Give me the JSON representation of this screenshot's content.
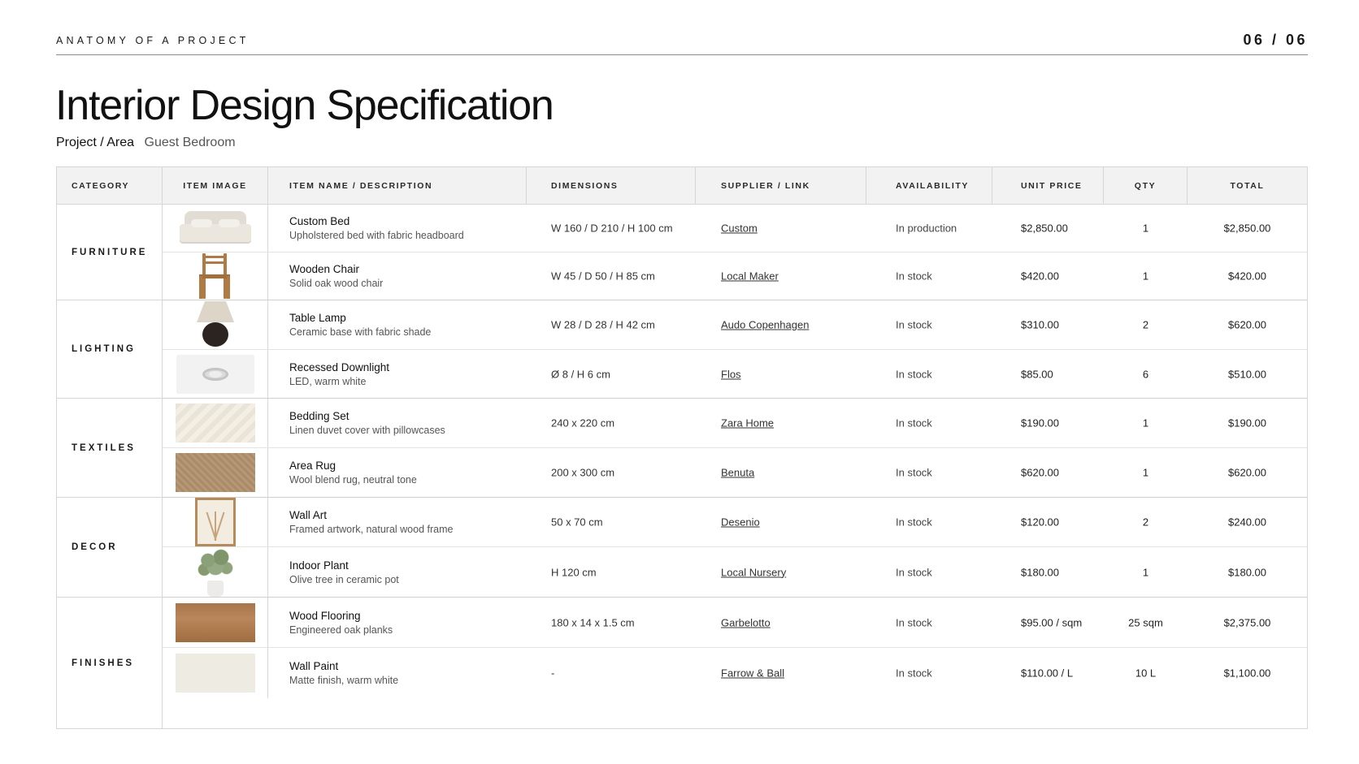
{
  "header": {
    "kicker": "ANATOMY OF A PROJECT",
    "page": "06 / 06"
  },
  "title": "Interior Design Specification",
  "project": {
    "label": "Project / Area",
    "value": "Guest Bedroom"
  },
  "table": {
    "columns": [
      "CATEGORY",
      "ITEM IMAGE",
      "ITEM NAME / DESCRIPTION",
      "DIMENSIONS",
      "SUPPLIER / LINK",
      "AVAILABILITY",
      "UNIT PRICE",
      "QTY",
      "TOTAL"
    ],
    "categories": [
      "FURNITURE",
      "LIGHTING",
      "TEXTILES",
      "DECOR",
      "FINISHES"
    ],
    "rows": [
      {
        "image": "bed-image",
        "name": "Custom Bed",
        "description": "Upholstered bed with fabric headboard",
        "dimensions": "W 160 / D 210 / H 100 cm",
        "supplier": "Custom",
        "availability": "In production",
        "unit_price": "$2,850.00",
        "qty": "1",
        "total": "$2,850.00"
      },
      {
        "image": "chair-image",
        "name": "Wooden Chair",
        "description": "Solid oak wood chair",
        "dimensions": "W 45 / D 50 / H 85 cm",
        "supplier": "Local Maker",
        "availability": "In stock",
        "unit_price": "$420.00",
        "qty": "1",
        "total": "$420.00"
      },
      {
        "image": "lamp-image",
        "name": "Table Lamp",
        "description": "Ceramic base with fabric shade",
        "dimensions": "W 28 / D 28 / H 42 cm",
        "supplier": "Audo Copenhagen",
        "availability": "In stock",
        "unit_price": "$310.00",
        "qty": "2",
        "total": "$620.00"
      },
      {
        "image": "downlight-image",
        "name": "Recessed Downlight",
        "description": "LED, warm white",
        "dimensions": "Ø 8 / H 6 cm",
        "supplier": "Flos",
        "availability": "In stock",
        "unit_price": "$85.00",
        "qty": "6",
        "total": "$510.00"
      },
      {
        "image": "bedding-image",
        "name": "Bedding Set",
        "description": "Linen duvet cover with pillowcases",
        "dimensions": "240 x 220 cm",
        "supplier": "Zara Home",
        "availability": "In stock",
        "unit_price": "$190.00",
        "qty": "1",
        "total": "$190.00"
      },
      {
        "image": "rug-image",
        "name": "Area Rug",
        "description": "Wool blend rug, neutral tone",
        "dimensions": "200 x 300 cm",
        "supplier": "Benuta",
        "availability": "In stock",
        "unit_price": "$620.00",
        "qty": "1",
        "total": "$620.00"
      },
      {
        "image": "wall-art-image",
        "name": "Wall Art",
        "description": "Framed artwork, natural wood frame",
        "dimensions": "50 x 70 cm",
        "supplier": "Desenio",
        "availability": "In stock",
        "unit_price": "$120.00",
        "qty": "2",
        "total": "$240.00"
      },
      {
        "image": "plant-image",
        "name": "Indoor Plant",
        "description": "Olive tree in ceramic pot",
        "dimensions": "H 120 cm",
        "supplier": "Local Nursery",
        "availability": "In stock",
        "unit_price": "$180.00",
        "qty": "1",
        "total": "$180.00"
      },
      {
        "image": "wood-flooring-image",
        "name": "Wood Flooring",
        "description": "Engineered oak planks",
        "dimensions": "180 x 14 x 1.5 cm",
        "supplier": "Garbelotto",
        "availability": "In stock",
        "unit_price": "$95.00 / sqm",
        "qty": "25 sqm",
        "total": "$2,375.00"
      },
      {
        "image": "wall-paint-image",
        "name": "Wall Paint",
        "description": "Matte finish, warm white",
        "dimensions": "-",
        "supplier": "Farrow & Ball",
        "availability": "In stock",
        "unit_price": "$110.00 / L",
        "qty": "10 L",
        "total": "$1,100.00"
      }
    ]
  }
}
